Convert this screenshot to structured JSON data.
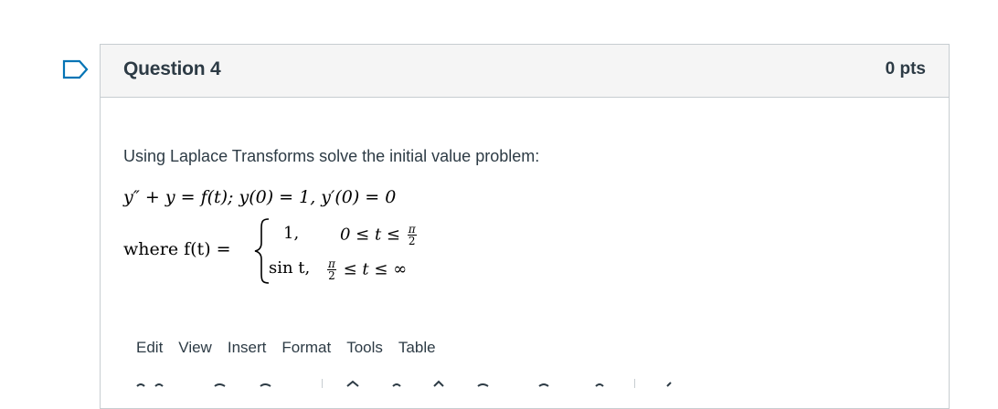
{
  "question": {
    "title": "Question 4",
    "points": "0 pts"
  },
  "body": {
    "prompt": "Using Laplace Transforms solve the initial value problem:",
    "equation": "y″ + y = f(t);  y(0) = 1, y′(0) = 0",
    "where_label": "where f(t) =",
    "cases": [
      {
        "value": "1,",
        "cond_left": "0 ≤ t ≤",
        "cond_frac_num": "π",
        "cond_frac_den": "2"
      },
      {
        "value": "sin t,",
        "cond_frac_num": "π",
        "cond_frac_den": "2",
        "cond_right": "≤ t ≤ ∞"
      }
    ]
  },
  "editor": {
    "menu": [
      "Edit",
      "View",
      "Insert",
      "Format",
      "Tools",
      "Table"
    ]
  },
  "icons": {
    "flag": "flag-icon",
    "brace": "left-brace-icon"
  },
  "colors": {
    "text": "#2d3b45",
    "header_bg": "#f5f5f5",
    "border": "#c7cdd1",
    "flag": "#0374b5"
  }
}
